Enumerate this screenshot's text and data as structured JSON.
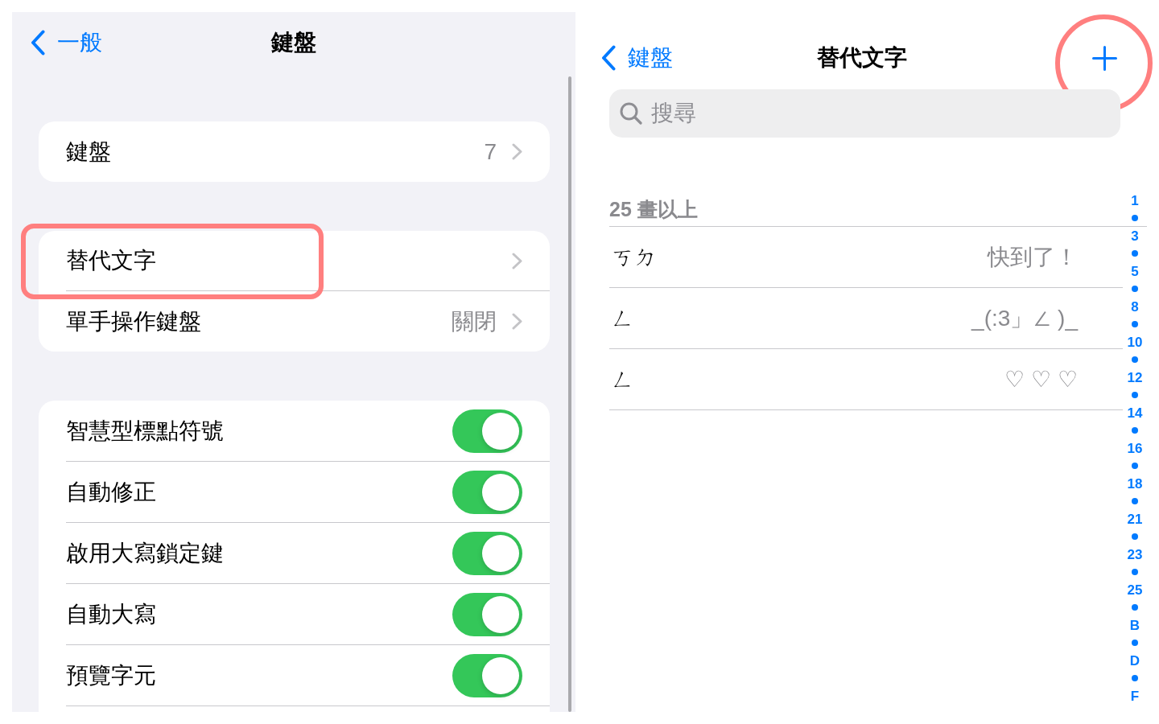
{
  "settings_panel": {
    "nav": {
      "back": "一般",
      "title": "鍵盤"
    },
    "groups": [
      {
        "rows": [
          {
            "kind": "link",
            "label": "鍵盤",
            "value": "7",
            "highlighted": false
          }
        ]
      },
      {
        "rows": [
          {
            "kind": "link",
            "label": "替代文字",
            "highlighted": true
          },
          {
            "kind": "link",
            "label": "單手操作鍵盤",
            "value": "關閉",
            "highlighted": false
          }
        ]
      },
      {
        "rows": [
          {
            "kind": "toggle",
            "label": "智慧型標點符號",
            "on": true
          },
          {
            "kind": "toggle",
            "label": "自動修正",
            "on": true
          },
          {
            "kind": "toggle",
            "label": "啟用大寫鎖定鍵",
            "on": true
          },
          {
            "kind": "toggle",
            "label": "自動大寫",
            "on": true
          },
          {
            "kind": "toggle",
            "label": "預覽字元",
            "on": true
          }
        ]
      }
    ]
  },
  "text_replacement_panel": {
    "nav": {
      "back": "鍵盤",
      "title": "替代文字",
      "add_button": {
        "highlighted": true
      }
    },
    "search": {
      "placeholder": "搜尋"
    },
    "section": {
      "header": "25 畫以上",
      "rows": [
        {
          "title": "ㄎㄉ",
          "detail": "快到了！"
        },
        {
          "title": "ㄥ",
          "detail": "_(:3」∠ )_"
        },
        {
          "title": "ㄥ",
          "detail": "♡ ♡ ♡"
        }
      ]
    },
    "index": [
      "1",
      "3",
      "5",
      "8",
      "10",
      "12",
      "14",
      "16",
      "18",
      "21",
      "23",
      "25",
      "B",
      "D",
      "F"
    ]
  }
}
